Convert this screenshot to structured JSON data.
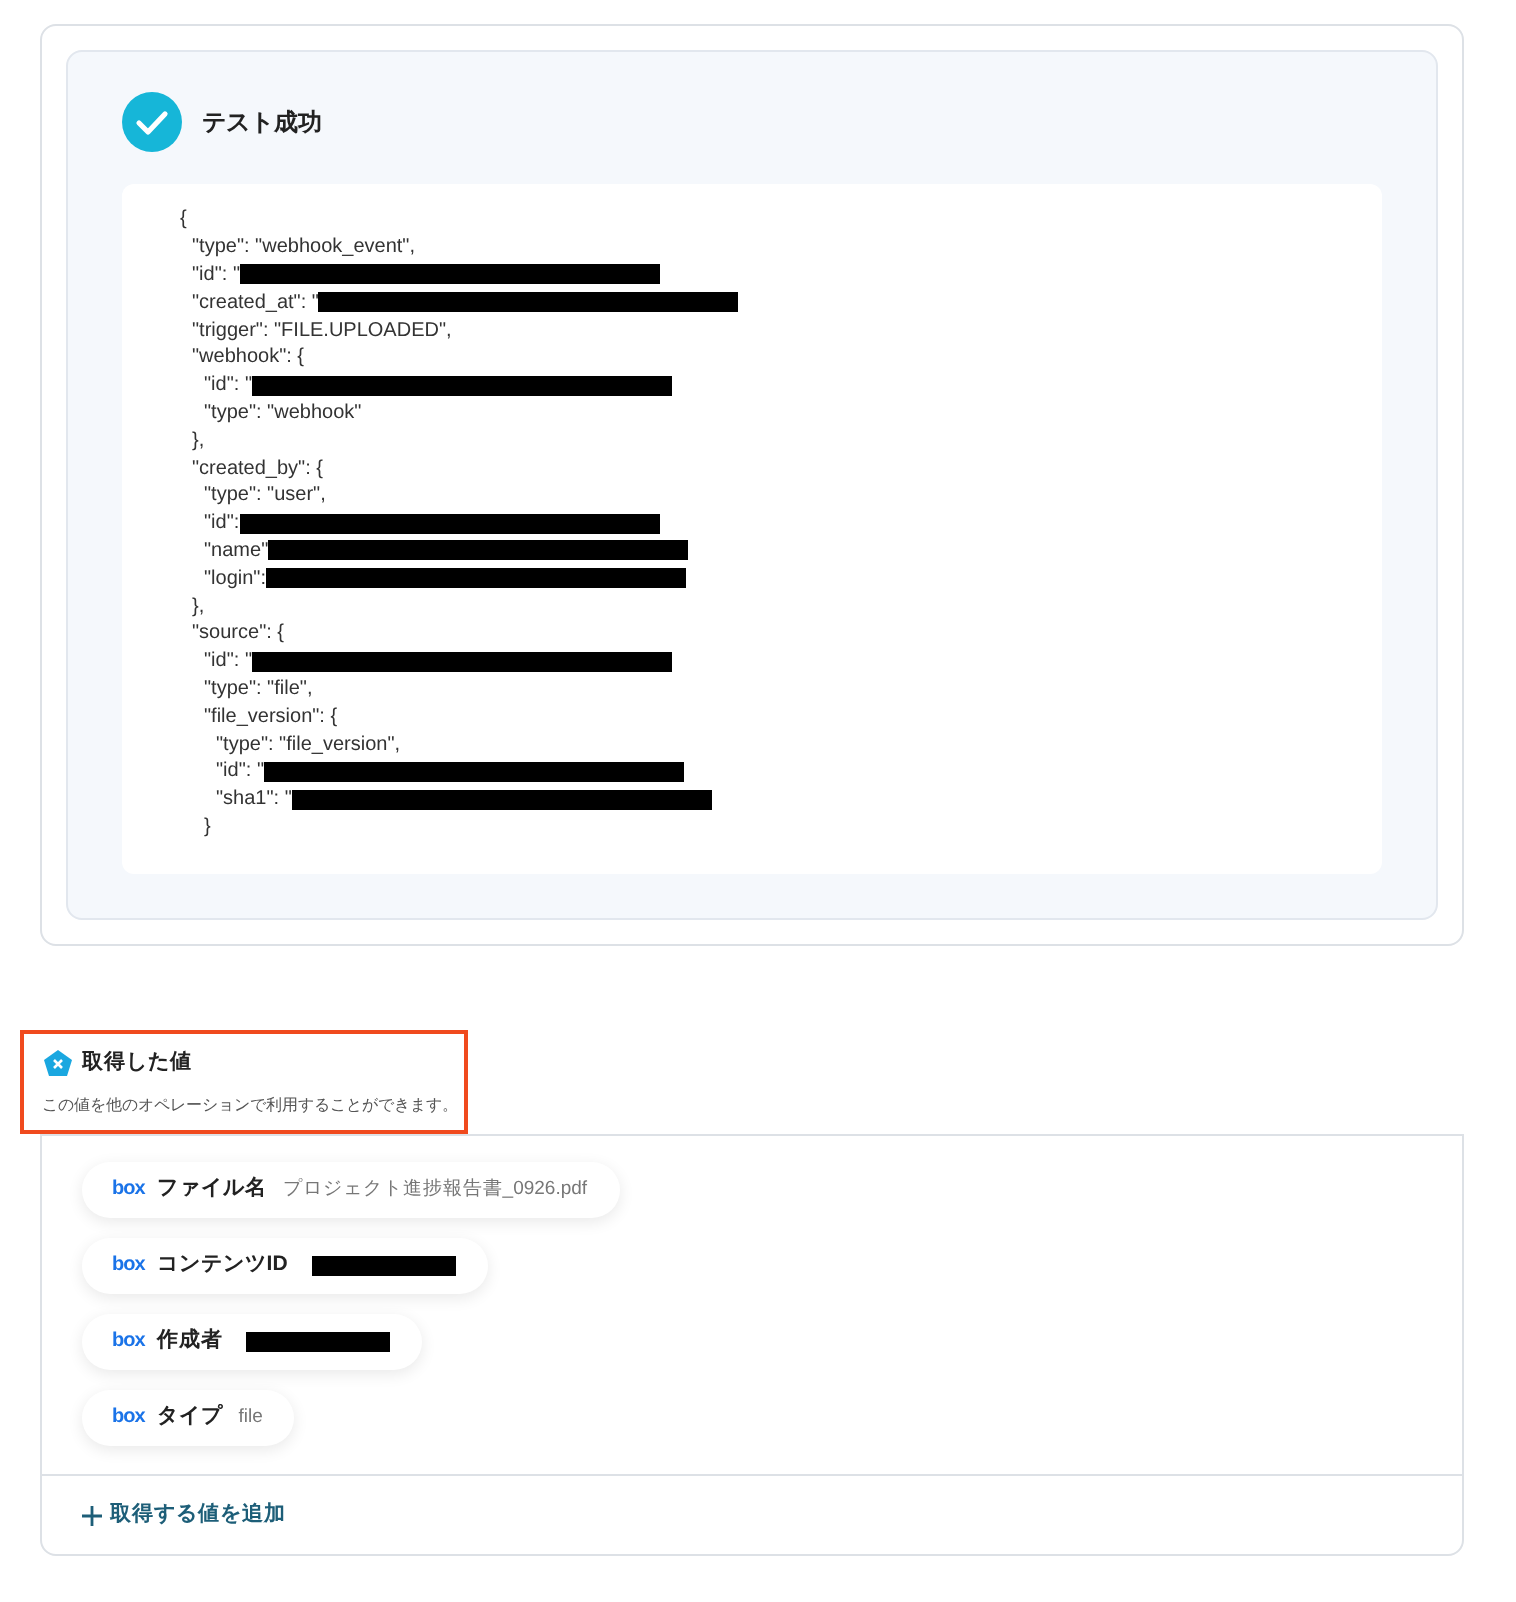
{
  "test_result": {
    "title": "テスト成功",
    "code": [
      {
        "text": "{",
        "children": [
          {
            "text": "\"type\": \"webhook_event\","
          },
          {
            "text": "\"id\": \"",
            "redacted": true
          },
          {
            "text": "\"created_at\": \"",
            "redacted": true
          },
          {
            "text": "\"trigger\": \"FILE.UPLOADED\","
          },
          {
            "text": "\"webhook\": {",
            "children": [
              {
                "text": "\"id\": \"",
                "redacted": true
              },
              {
                "text": "\"type\": \"webhook\""
              }
            ]
          },
          {
            "text": "},"
          },
          {
            "text": "\"created_by\": {",
            "children": [
              {
                "text": "\"type\": \"user\","
              },
              {
                "text": "\"id\":",
                "redacted": true
              },
              {
                "text": "\"name\"",
                "redacted": true
              },
              {
                "text": "\"login\":",
                "redacted": true
              }
            ]
          },
          {
            "text": "},"
          },
          {
            "text": "\"source\": {",
            "children": [
              {
                "text": "\"id\": \"",
                "redacted": true
              },
              {
                "text": "\"type\": \"file\","
              },
              {
                "text": "\"file_version\": {",
                "children": [
                  {
                    "text": "\"type\": \"file_version\","
                  },
                  {
                    "text": "\"id\": \"",
                    "redacted": true
                  },
                  {
                    "text": "\"sha1\": \"",
                    "redacted": true
                  }
                ]
              },
              {
                "text": "}"
              }
            ]
          }
        ]
      }
    ]
  },
  "acquired_values": {
    "title": "取得した値",
    "description": "この値を他のオペレーションで利用することができます。",
    "items": [
      {
        "logo": "box",
        "label": "ファイル名",
        "value": "プロジェクト進捗報告書_0926.pdf",
        "redacted": false
      },
      {
        "logo": "box",
        "label": "コンテンツID",
        "redacted": true
      },
      {
        "logo": "box",
        "label": "作成者",
        "redacted": true
      },
      {
        "logo": "box",
        "label": "タイプ",
        "value": "file",
        "redacted": false
      }
    ],
    "add_button": "取得する値を追加"
  }
}
